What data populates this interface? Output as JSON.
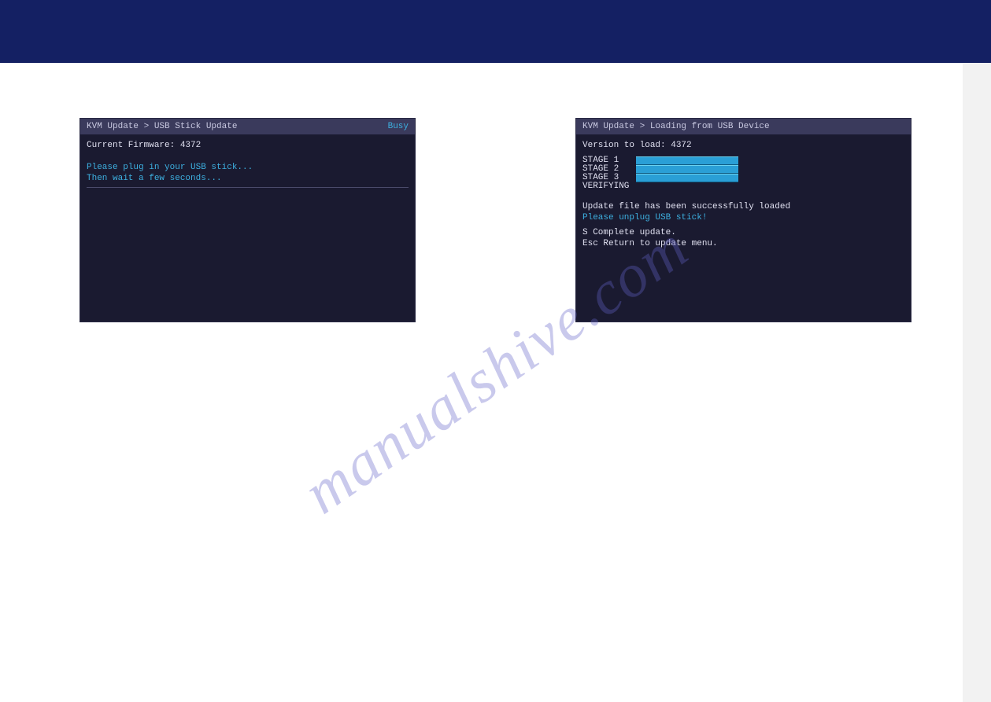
{
  "watermark_text": "manualshive.com",
  "osd_left": {
    "breadcrumb": "KVM Update > USB Stick Update",
    "status": "Busy",
    "firmware_line": "Current Firmware: 4372",
    "msg1": "Please plug in your USB stick...",
    "msg2": "Then wait a few seconds..."
  },
  "osd_right": {
    "breadcrumb": "KVM Update > Loading from USB Device",
    "version_line": "Version to load: 4372",
    "stages": [
      {
        "label": "STAGE 1",
        "filled": true
      },
      {
        "label": "STAGE 2",
        "filled": true
      },
      {
        "label": "STAGE 3",
        "filled": true
      },
      {
        "label": "VERIFYING",
        "filled": false
      }
    ],
    "success_msg": "Update file has been successfully loaded",
    "unplug_msg": "Please unplug USB stick!",
    "key_s": "S   Complete update.",
    "key_esc": "Esc Return to update menu."
  }
}
